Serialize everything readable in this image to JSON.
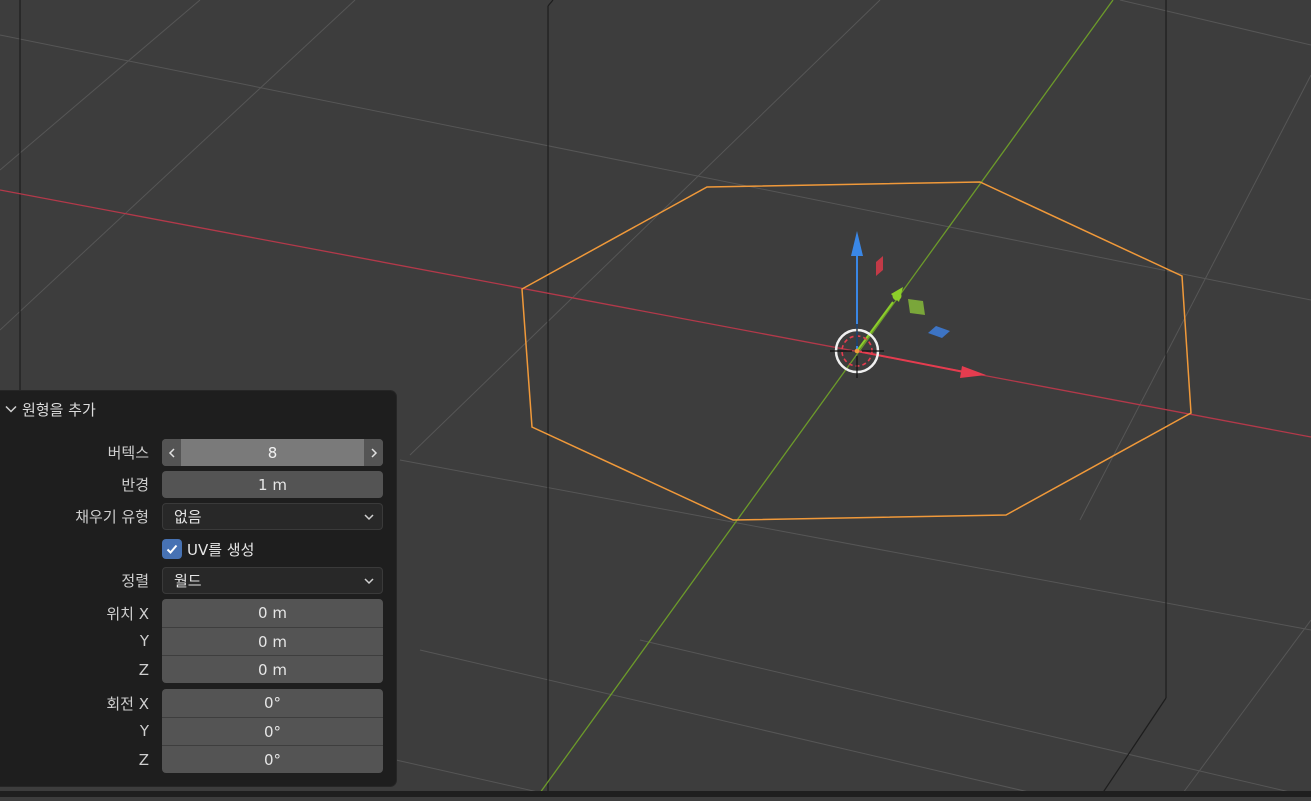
{
  "panel": {
    "title": "원형을 추가",
    "vertices": {
      "label": "버텍스",
      "value": "8"
    },
    "radius": {
      "label": "반경",
      "value": "1 m"
    },
    "fill_type": {
      "label": "채우기 유형",
      "value": "없음"
    },
    "generate_uv": {
      "label": "UV를 생성",
      "checked": true
    },
    "align": {
      "label": "정렬",
      "value": "월드"
    },
    "location": {
      "label": "위치",
      "x_label": "X",
      "y_label": "Y",
      "z_label": "Z",
      "x": "0 m",
      "y": "0 m",
      "z": "0 m"
    },
    "rotation": {
      "label": "회전",
      "x_label": "X",
      "y_label": "Y",
      "z_label": "Z",
      "x": "0°",
      "y": "0°",
      "z": "0°"
    }
  },
  "colors": {
    "viewport_bg": "#3d3d3d",
    "grid": "#565656",
    "x_axis": "#b3394a",
    "y_axis": "#6c9a2a",
    "selection_outline": "#f0993a",
    "gizmo_x": "#e53c4f",
    "gizmo_y": "#8ccf2a",
    "gizmo_z": "#3a87e6",
    "panel_bg": "#1e1e1e",
    "checkbox_accent": "#4772b3"
  },
  "icons": {
    "panel_toggle": "chevron-down-icon",
    "stepper_left": "chevron-left-icon",
    "stepper_right": "chevron-right-icon",
    "dropdown": "chevron-down-icon",
    "checkbox": "checkmark-icon",
    "cursor": "3d-cursor-icon"
  }
}
